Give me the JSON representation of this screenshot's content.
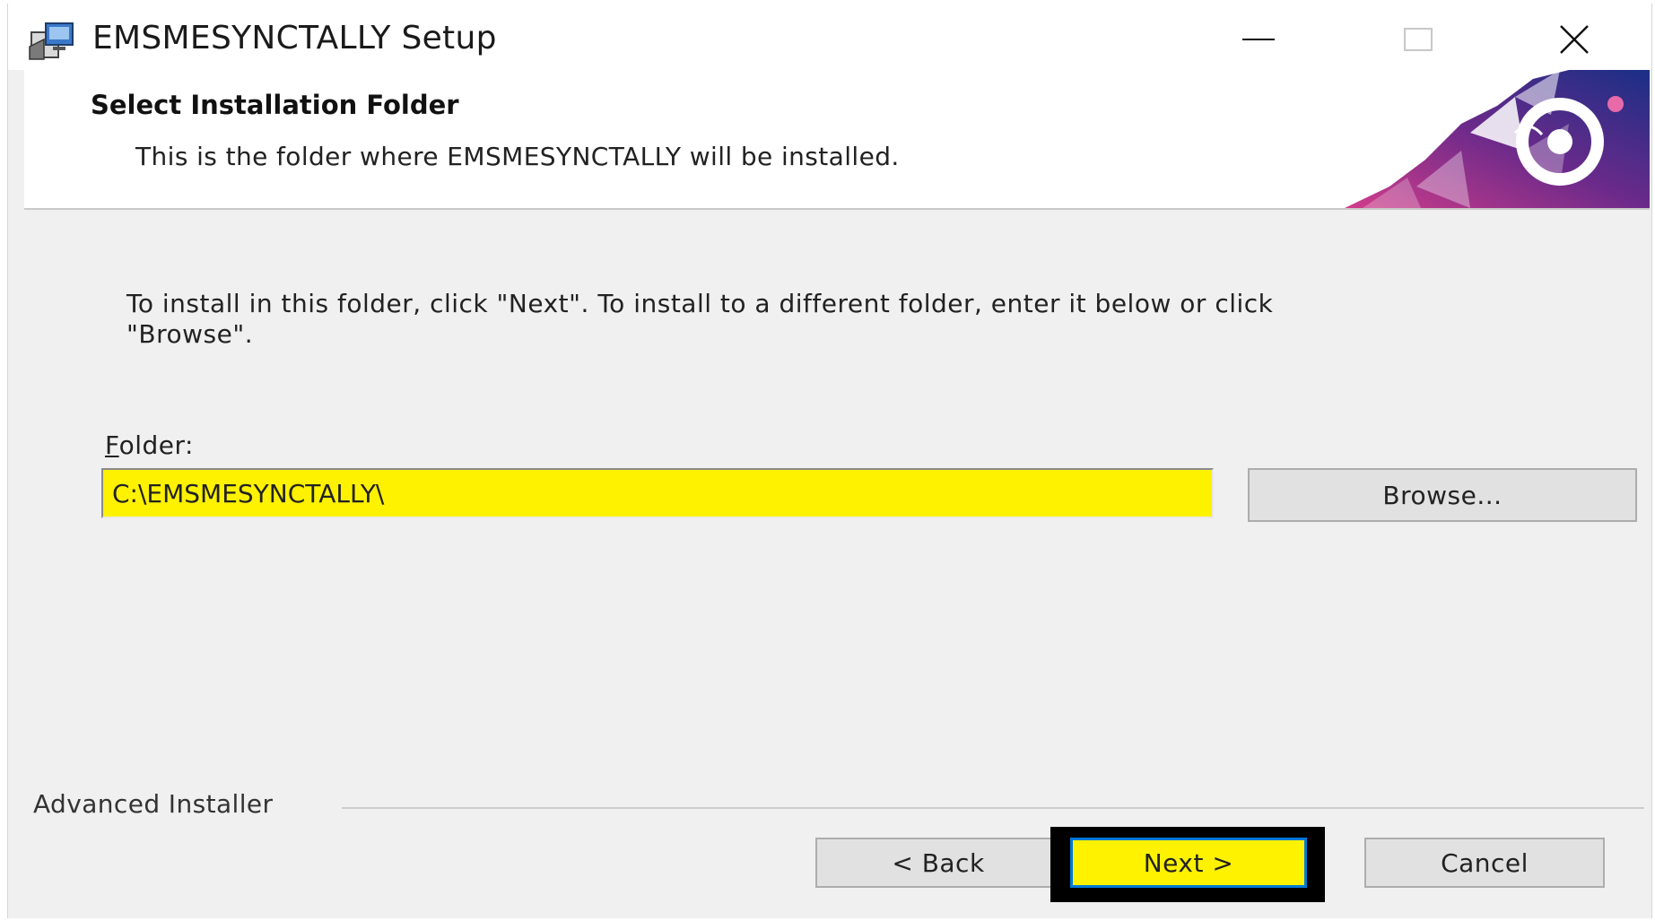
{
  "window": {
    "title": "EMSMESYNCTALLY Setup",
    "controls": {
      "minimize": "minimize-icon",
      "maximize": "maximize-icon",
      "close": "close-icon"
    }
  },
  "header": {
    "title": "Select Installation Folder",
    "description": "This is the folder where EMSMESYNCTALLY will be installed."
  },
  "body": {
    "instructions_line1": "To install in this folder, click \"Next\". To install to a different folder, enter it below or click",
    "instructions_line2": "\"Browse\".",
    "folder_label_accel": "F",
    "folder_label_rest": "older:",
    "folder_value": "C:\\EMSMESYNCTALLY\\",
    "browse_label": "Browse..."
  },
  "footer": {
    "brand": "Advanced Installer",
    "back_label": "< Back",
    "next_label": "Next >",
    "cancel_label": "Cancel"
  },
  "colors": {
    "highlight": "#fff200",
    "focus_border": "#0078d7",
    "dialog_bg": "#f0f0f0"
  }
}
